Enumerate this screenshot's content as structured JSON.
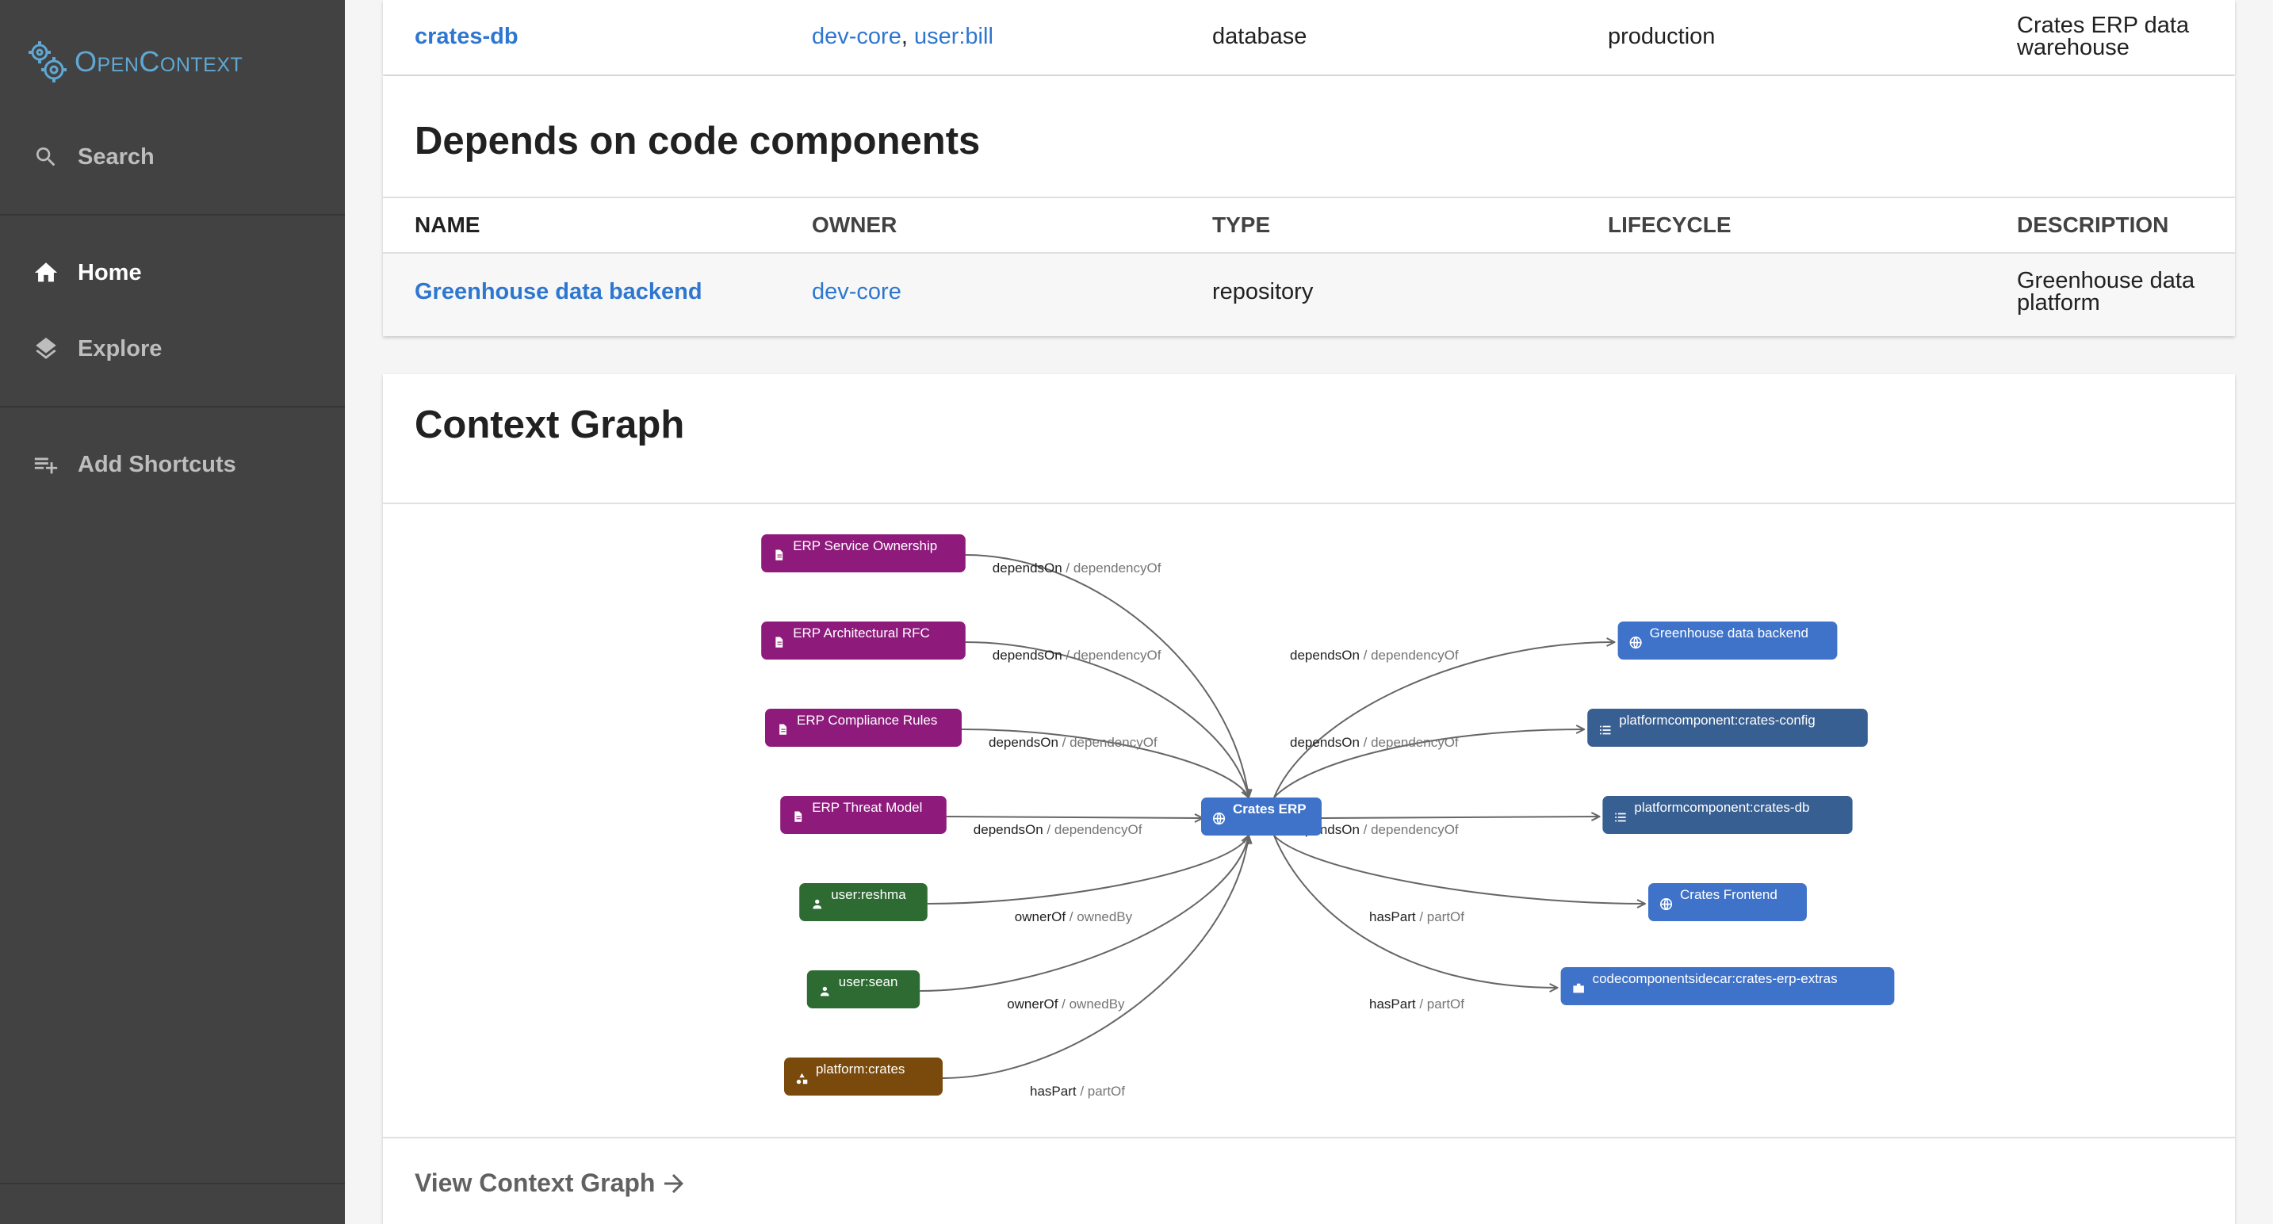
{
  "sidebar": {
    "logo_text": "OpenContext",
    "search_label": "Search",
    "home_label": "Home",
    "explore_label": "Explore",
    "add_shortcuts_label": "Add Shortcuts"
  },
  "top_table": {
    "row": {
      "name": "crates-db",
      "owner_1": "dev-core",
      "owner_sep": ",",
      "owner_2": "user:bill",
      "type": "database",
      "lifecycle": "production",
      "description_line1": "Crates ERP data",
      "description_line2": "warehouse"
    }
  },
  "code_components": {
    "title": "Depends on code components",
    "headers": {
      "name": "NAME",
      "owner": "OWNER",
      "type": "TYPE",
      "lifecycle": "LIFECYCLE",
      "description": "DESCRIPTION"
    },
    "row": {
      "name": "Greenhouse data backend",
      "owner": "dev-core",
      "type": "repository",
      "lifecycle": "",
      "description_line1": "Greenhouse data",
      "description_line2": "platform"
    }
  },
  "context_graph": {
    "title": "Context Graph",
    "view_link": "View Context Graph",
    "center": "Crates ERP",
    "left_nodes": [
      {
        "label": "ERP Service Ownership",
        "rel": "dependsOn",
        "inv": "dependencyOf",
        "color": "#8e1b7c",
        "icon": "document"
      },
      {
        "label": "ERP Architectural RFC",
        "rel": "dependsOn",
        "inv": "dependencyOf",
        "color": "#8e1b7c",
        "icon": "document"
      },
      {
        "label": "ERP Compliance Rules",
        "rel": "dependsOn",
        "inv": "dependencyOf",
        "color": "#8e1b7c",
        "icon": "document"
      },
      {
        "label": "ERP Threat Model",
        "rel": "dependsOn",
        "inv": "dependencyOf",
        "color": "#8e1b7c",
        "icon": "document"
      },
      {
        "label": "user:reshma",
        "rel": "ownerOf",
        "inv": "ownedBy",
        "color": "#2e6b32",
        "icon": "person"
      },
      {
        "label": "user:sean",
        "rel": "ownerOf",
        "inv": "ownedBy",
        "color": "#2e6b32",
        "icon": "person"
      },
      {
        "label": "platform:crates",
        "rel": "hasPart",
        "inv": "partOf",
        "color": "#7a4a0c",
        "icon": "shapes"
      }
    ],
    "right_nodes": [
      {
        "label": "Greenhouse data backend",
        "rel": "dependsOn",
        "inv": "dependencyOf",
        "color": "#3f73c9",
        "icon": "globe"
      },
      {
        "label": "platformcomponent:crates-config",
        "rel": "dependsOn",
        "inv": "dependencyOf",
        "color": "#385f91",
        "icon": "list"
      },
      {
        "label": "platformcomponent:crates-db",
        "rel": "dependsOn",
        "inv": "dependencyOf",
        "color": "#385f91",
        "icon": "list"
      },
      {
        "label": "Crates Frontend",
        "rel": "hasPart",
        "inv": "partOf",
        "color": "#3f73c9",
        "icon": "globe"
      },
      {
        "label": "codecomponentsidecar:crates-erp-extras",
        "rel": "hasPart",
        "inv": "partOf",
        "color": "#3f73c9",
        "icon": "briefcase"
      }
    ],
    "colors": {
      "center": "#3f73c9",
      "edge": "#666666",
      "rel_text": "#212121",
      "inv_text": "#757575"
    }
  }
}
